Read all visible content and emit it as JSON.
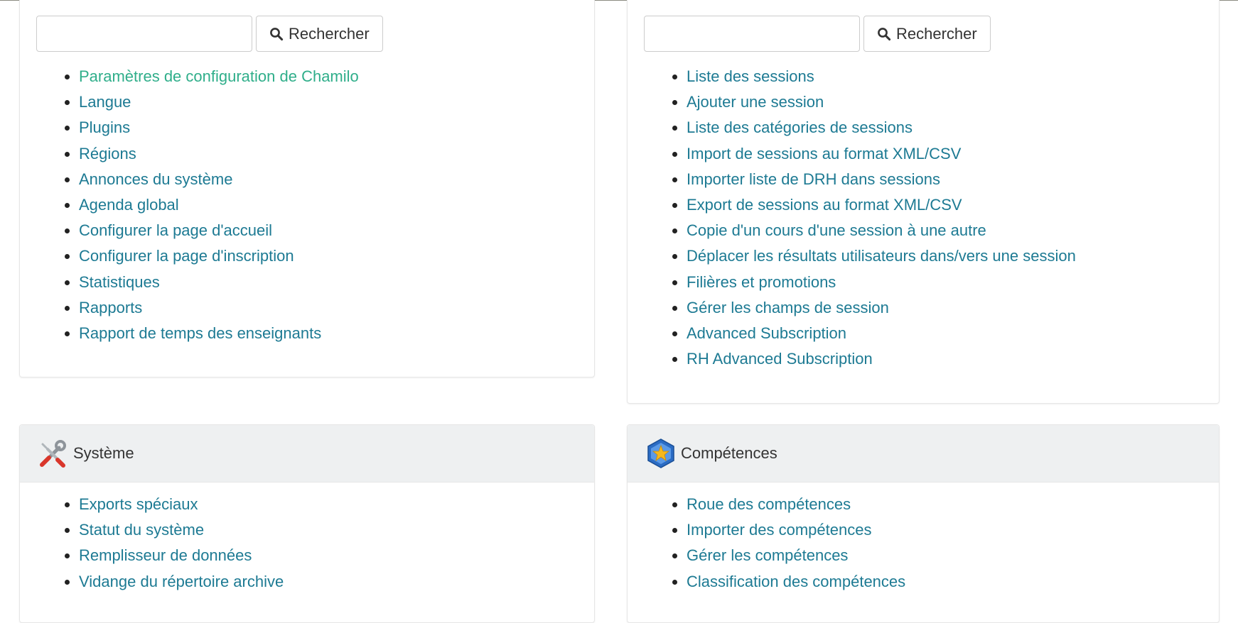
{
  "search": {
    "left": {
      "value": "",
      "button_label": "Rechercher"
    },
    "right": {
      "value": "",
      "button_label": "Rechercher"
    }
  },
  "platform_links": [
    "Paramètres de configuration de Chamilo",
    "Langue",
    "Plugins",
    "Régions",
    "Annonces du système",
    "Agenda global",
    "Configurer la page d'accueil",
    "Configurer la page d'inscription",
    "Statistiques",
    "Rapports",
    "Rapport de temps des enseignants"
  ],
  "session_links": [
    "Liste des sessions",
    "Ajouter une session",
    "Liste des catégories de sessions",
    "Import de sessions au format XML/CSV",
    "Importer liste de DRH dans sessions",
    "Export de sessions au format XML/CSV",
    "Copie d'un cours d'une session à une autre",
    "Déplacer les résultats utilisateurs dans/vers une session",
    "Filières et promotions",
    "Gérer les champs de session",
    "Advanced Subscription",
    "RH Advanced Subscription"
  ],
  "system": {
    "title": "Système",
    "icon": "tools-icon",
    "links": [
      "Exports spéciaux",
      "Statut du système",
      "Remplisseur de données",
      "Vidange du répertoire archive"
    ]
  },
  "skills": {
    "title": "Compétences",
    "icon": "star-badge-icon",
    "links": [
      "Roue des compétences",
      "Importer des compétences",
      "Gérer les compétences",
      "Classification des compétences"
    ]
  },
  "colors": {
    "link": "#1d7a93",
    "visited_link": "#2fae8a",
    "header_bg": "#eef0f1"
  }
}
